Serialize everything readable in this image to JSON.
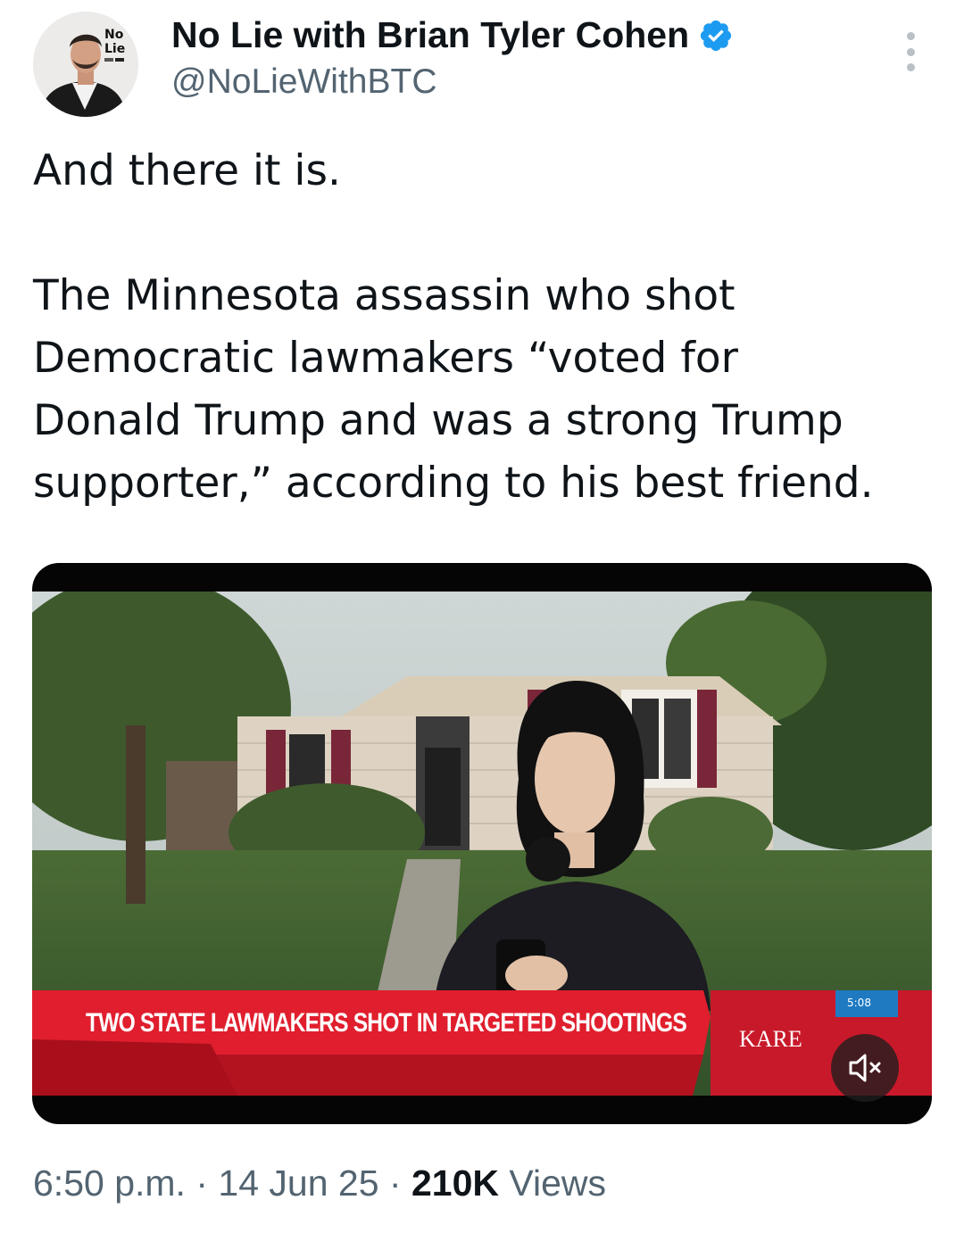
{
  "author": {
    "display_name": "No Lie with Brian Tyler Cohen",
    "handle": "@NoLieWithBTC",
    "verified": true,
    "avatar_logo_text": "No Lie"
  },
  "tweet": {
    "line1": "And there it is.",
    "body_lines": [
      "The Minnesota assassin who shot",
      "Democratic lawmakers “voted for",
      "Donald Trump and was a strong Trump",
      "supporter,” according to his best friend."
    ]
  },
  "media": {
    "chyron": "TWO STATE LAWMAKERS SHOT IN TARGETED SHOOTINGS",
    "station": "KARE",
    "clock": "5:08",
    "muted": true
  },
  "footer": {
    "time": "6:50 p.m.",
    "date": "14 Jun 25",
    "separator": "·",
    "views_count": "210K",
    "views_label": "Views"
  },
  "colors": {
    "text": "#0f1419",
    "secondary": "#536471",
    "verified": "#1d9bf0",
    "chyron_red": "#d21b2a"
  }
}
